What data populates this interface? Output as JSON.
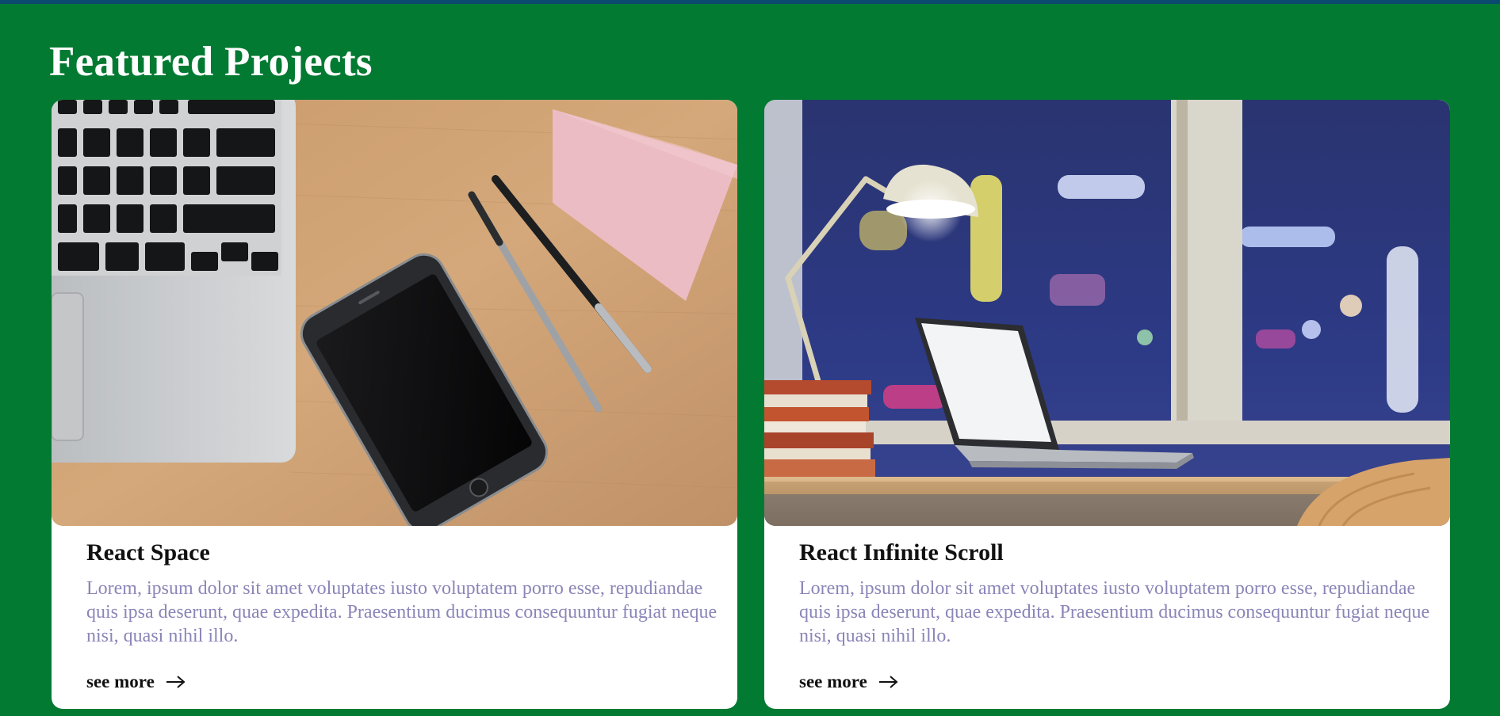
{
  "section": {
    "title": "Featured Projects"
  },
  "colors": {
    "background": "#037a32",
    "top_bar": "#0b4a6e",
    "card": "#ffffff",
    "description_text": "#8b85b8"
  },
  "projects": [
    {
      "title": "React Space",
      "description": "Lorem, ipsum dolor sit amet voluptates iusto voluptatem porro esse, repudiandae quis ipsa deserunt, quae expedita. Praesentium ducimus consequuntur fugiat neque nisi, quasi nihil illo.",
      "link_label": "see more",
      "link_icon": "arrow-right-icon",
      "image": "desk-with-laptop-phone-pens-sticky-note"
    },
    {
      "title": "React Infinite Scroll",
      "description": "Lorem, ipsum dolor sit amet voluptates iusto voluptatem porro esse, repudiandae quis ipsa deserunt, quae expedita. Praesentium ducimus consequuntur fugiat neque nisi, quasi nihil illo.",
      "link_label": "see more",
      "link_icon": "arrow-right-icon",
      "image": "laptop-on-desk-with-lamp-city-night-view"
    }
  ]
}
